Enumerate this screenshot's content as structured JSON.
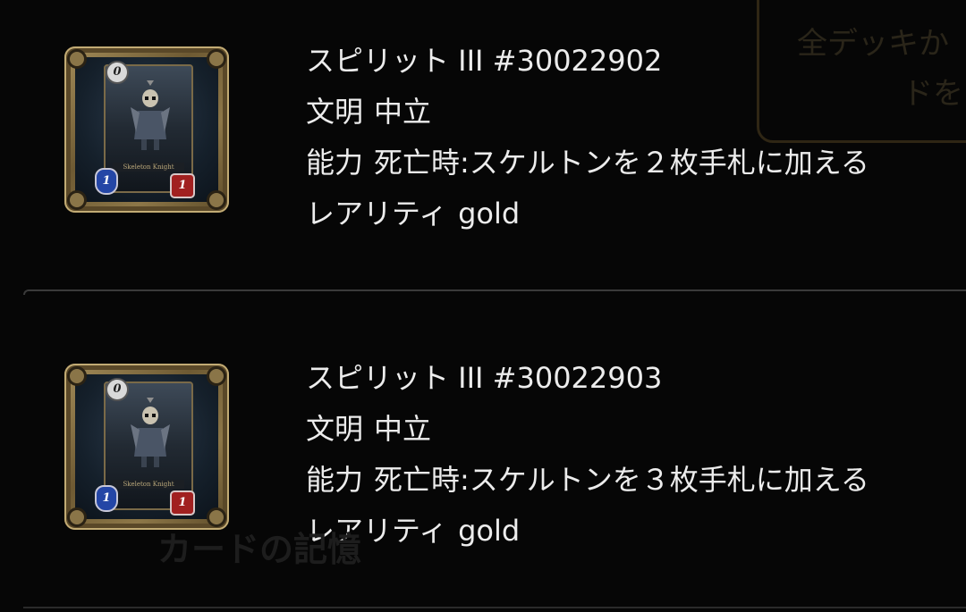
{
  "background_overlay": {
    "button_line1": "全デッキか",
    "button_line2": "ドを",
    "caption": "カードの記憶"
  },
  "cards": [
    {
      "card_art": {
        "cost": "0",
        "attack": "1",
        "defense": "1",
        "name": "Skeleton Knight"
      },
      "title": "スピリット III #30022902",
      "civilization_label": "文明",
      "civilization_value": "中立",
      "ability_label": "能力",
      "ability_value": "死亡時:スケルトンを２枚手札に加える",
      "rarity_label": "レアリティ",
      "rarity_value": "gold"
    },
    {
      "card_art": {
        "cost": "0",
        "attack": "1",
        "defense": "1",
        "name": "Skeleton Knight"
      },
      "title": "スピリット III #30022903",
      "civilization_label": "文明",
      "civilization_value": "中立",
      "ability_label": "能力",
      "ability_value": "死亡時:スケルトンを３枚手札に加える",
      "rarity_label": "レアリティ",
      "rarity_value": "gold"
    }
  ],
  "colors": {
    "background": "#060606",
    "text": "#ececec",
    "frame_gold": "#a48d5a",
    "attack_blue": "#2446a6",
    "defense_red": "#a12020"
  }
}
